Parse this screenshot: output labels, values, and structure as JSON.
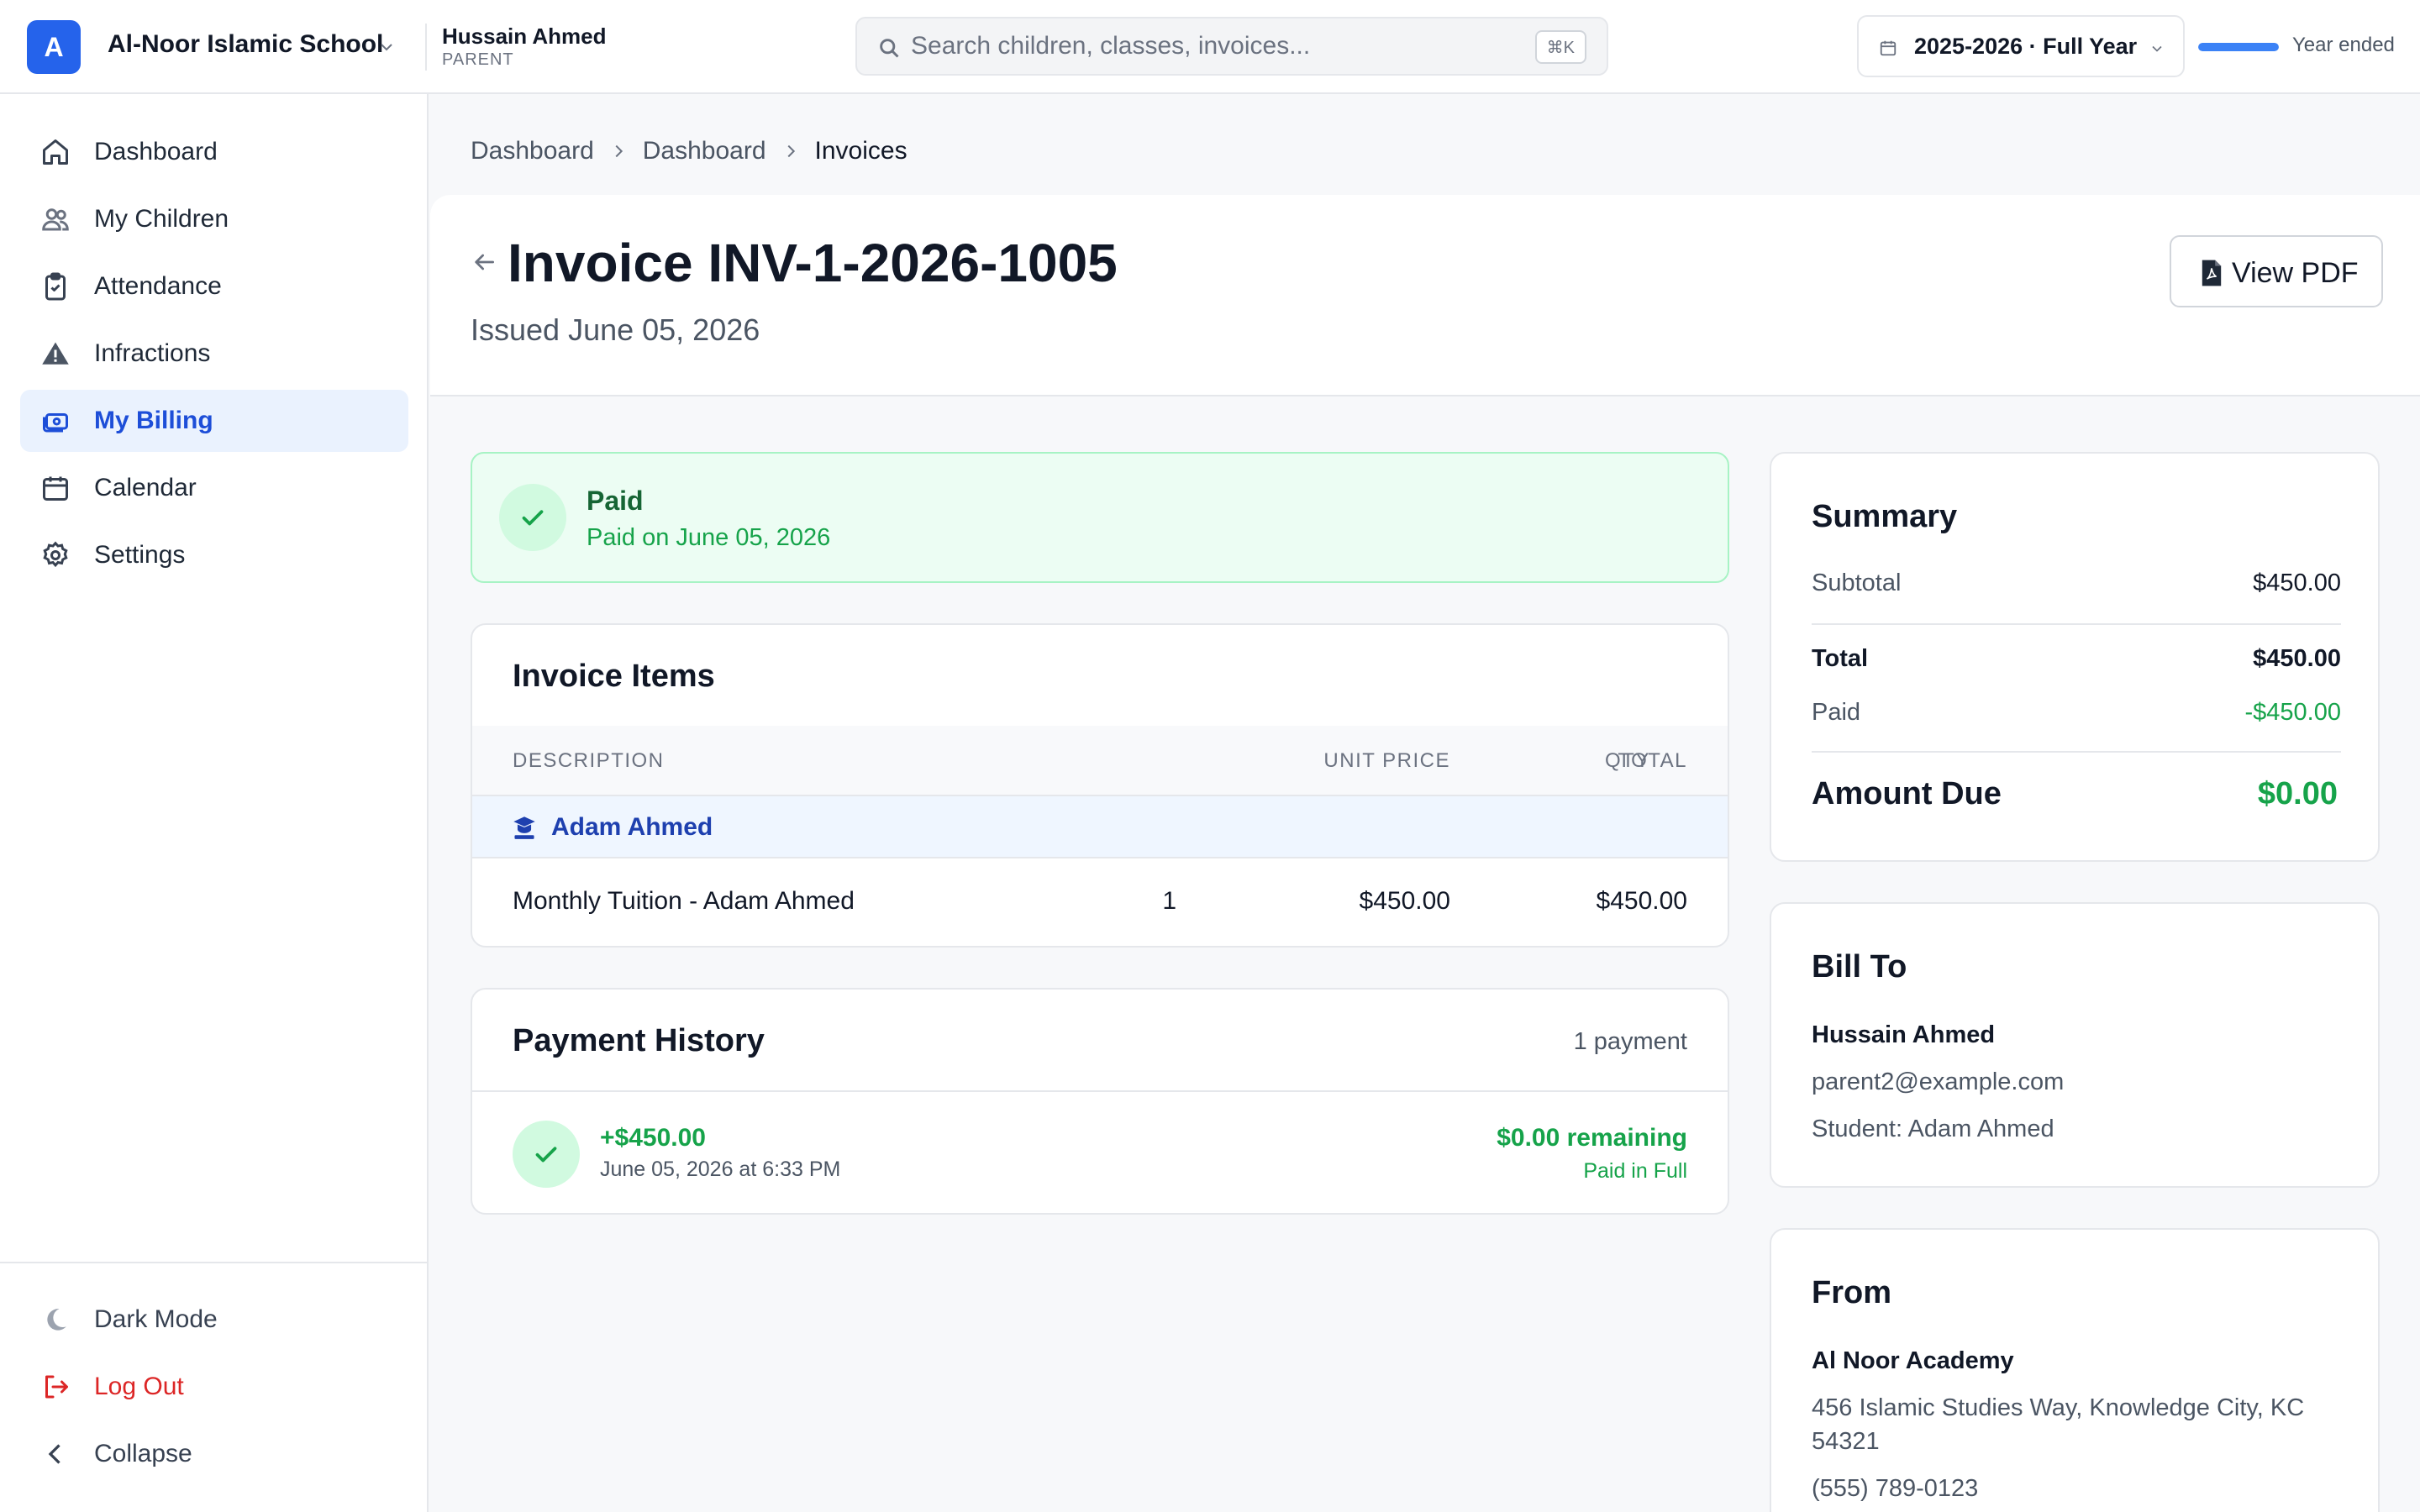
{
  "topbar": {
    "logo_letter": "A",
    "school_name": "Al-Noor Islamic School",
    "user_name": "Hussain Ahmed",
    "user_role": "PARENT",
    "search_placeholder": "Search children, classes, invoices...",
    "search_shortcut": "⌘K",
    "year_label": "2025-2026 · Full Year",
    "year_progress_fraction": 1.0,
    "year_status": "Year ended"
  },
  "sidebar": {
    "items": [
      {
        "label": "Dashboard",
        "icon": "home-icon"
      },
      {
        "label": "My Children",
        "icon": "users-icon"
      },
      {
        "label": "Attendance",
        "icon": "clipboard-check-icon"
      },
      {
        "label": "Infractions",
        "icon": "warning-icon"
      },
      {
        "label": "My Billing",
        "icon": "billing-icon",
        "active": true
      },
      {
        "label": "Calendar",
        "icon": "calendar-icon"
      },
      {
        "label": "Settings",
        "icon": "gear-icon"
      }
    ],
    "bottom": {
      "dark_mode": "Dark Mode",
      "logout": "Log Out",
      "collapse": "Collapse"
    }
  },
  "breadcrumb": [
    "Dashboard",
    "Dashboard",
    "Invoices"
  ],
  "invoice": {
    "title": "Invoice INV-1-2026-1005",
    "issued": "Issued June 05, 2026",
    "view_pdf": "View PDF"
  },
  "status": {
    "title": "Paid",
    "subtitle": "Paid on June 05, 2026"
  },
  "items": {
    "title": "Invoice Items",
    "headers": {
      "description": "DESCRIPTION",
      "qty": "QTY",
      "unit_price": "UNIT PRICE",
      "total": "TOTAL"
    },
    "student": "Adam Ahmed",
    "rows": [
      {
        "description": "Monthly Tuition - Adam Ahmed",
        "qty": "1",
        "unit_price": "$450.00",
        "total": "$450.00"
      }
    ]
  },
  "history": {
    "title": "Payment History",
    "count": "1 payment",
    "payments": [
      {
        "amount": "+$450.00",
        "date": "June 05, 2026 at 6:33 PM",
        "remaining": "$0.00 remaining",
        "status": "Paid in Full"
      }
    ]
  },
  "summary": {
    "title": "Summary",
    "subtotal_label": "Subtotal",
    "subtotal": "$450.00",
    "total_label": "Total",
    "total": "$450.00",
    "paid_label": "Paid",
    "paid": "-$450.00",
    "amount_due_label": "Amount Due",
    "amount_due": "$0.00"
  },
  "bill_to": {
    "title": "Bill To",
    "name": "Hussain Ahmed",
    "email": "parent2@example.com",
    "student": "Student: Adam Ahmed"
  },
  "from": {
    "title": "From",
    "name": "Al Noor Academy",
    "address": "456 Islamic Studies Way, Knowledge City, KC 54321",
    "phone": "(555) 789-0123"
  },
  "colors": {
    "accent": "#2563eb",
    "success": "#16a34a",
    "danger": "#dc2626"
  }
}
